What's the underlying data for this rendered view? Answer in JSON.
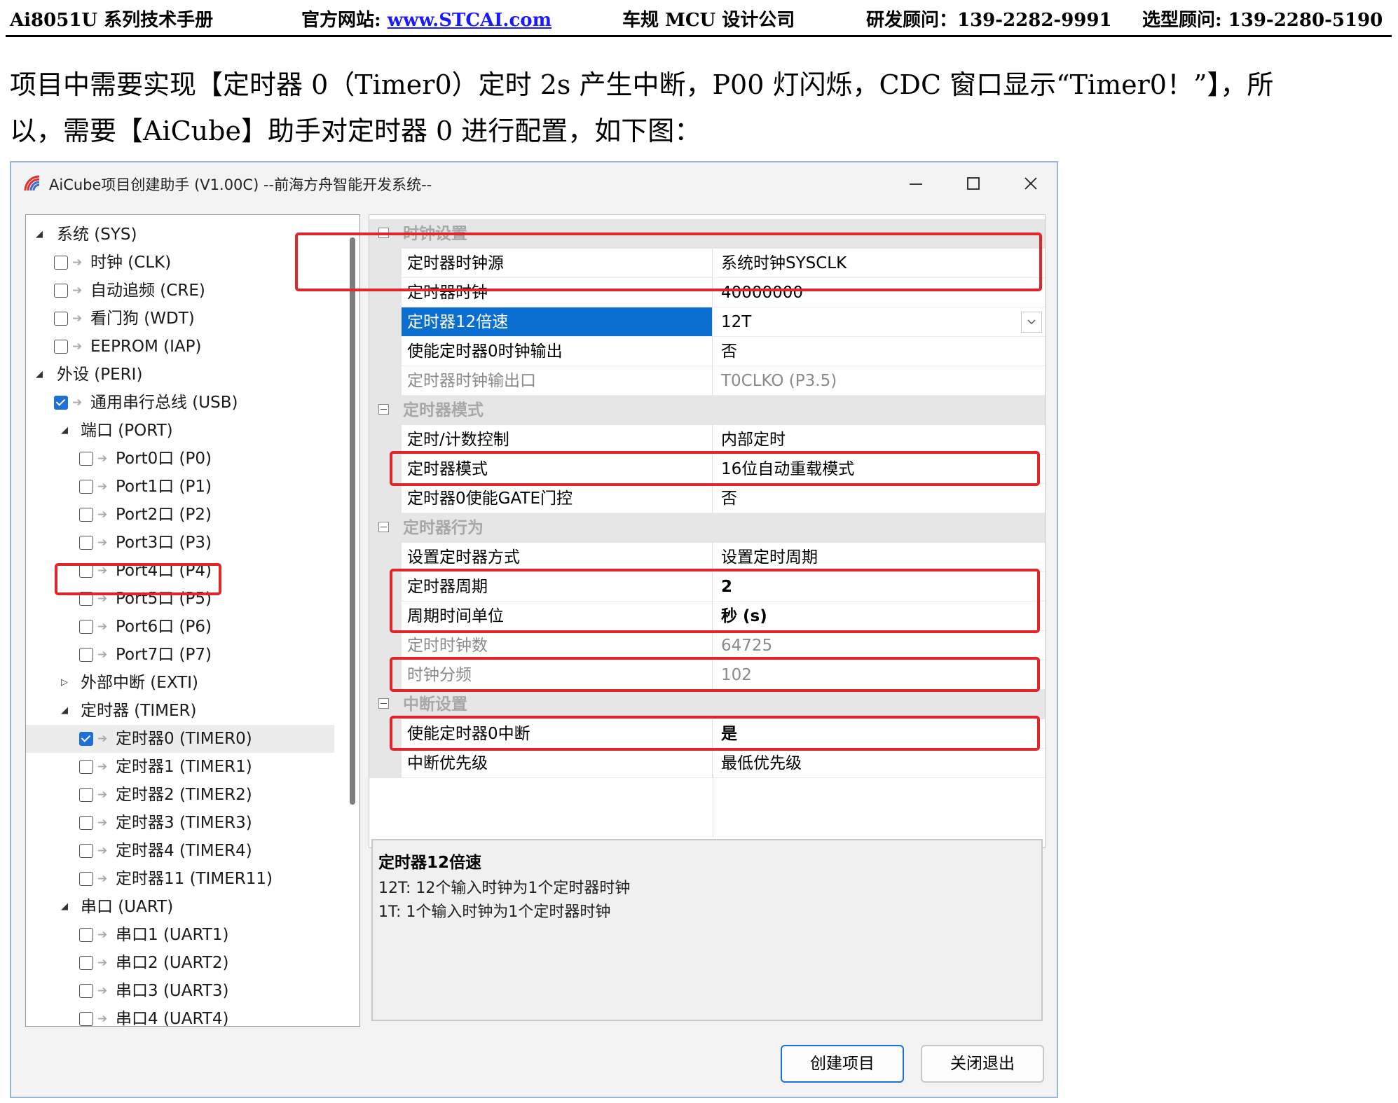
{
  "doc_header": {
    "manual": "Ai8051U 系列技术手册",
    "website_label": "官方网站: ",
    "website_url": "www.STCAI.com",
    "company": "车规 MCU 设计公司",
    "rd_advisor": "研发顾问：139-2282-9991",
    "selection_advisor": "选型顾问: 139-2280-5190"
  },
  "intro": {
    "line1": "项目中需要实现【定时器 0（Timer0）定时 2s 产生中断，P00 灯闪烁，CDC 窗口显示“Timer0！”】，所",
    "line2": "以，需要【AiCube】助手对定时器 0 进行配置，如下图："
  },
  "window": {
    "title": "AiCube项目创建助手 (V1.00C) --前海方舟智能开发系统--"
  },
  "tree": [
    {
      "label": "系统 (SYS)",
      "level": 0,
      "expander": "expanded"
    },
    {
      "label": "时钟 (CLK)",
      "level": 1,
      "checkbox": "unchecked"
    },
    {
      "label": "自动追频 (CRE)",
      "level": 1,
      "checkbox": "unchecked"
    },
    {
      "label": "看门狗 (WDT)",
      "level": 1,
      "checkbox": "unchecked"
    },
    {
      "label": "EEPROM (IAP)",
      "level": 1,
      "checkbox": "unchecked"
    },
    {
      "label": "外设 (PERI)",
      "level": 0,
      "expander": "expanded"
    },
    {
      "label": "通用串行总线 (USB)",
      "level": 1,
      "checkbox": "checked"
    },
    {
      "label": "端口 (PORT)",
      "level": 1,
      "expander": "expanded"
    },
    {
      "label": "Port0口 (P0)",
      "level": 2,
      "checkbox": "unchecked"
    },
    {
      "label": "Port1口 (P1)",
      "level": 2,
      "checkbox": "unchecked"
    },
    {
      "label": "Port2口 (P2)",
      "level": 2,
      "checkbox": "unchecked"
    },
    {
      "label": "Port3口 (P3)",
      "level": 2,
      "checkbox": "unchecked"
    },
    {
      "label": "Port4口 (P4)",
      "level": 2,
      "checkbox": "unchecked"
    },
    {
      "label": "Port5口 (P5)",
      "level": 2,
      "checkbox": "unchecked"
    },
    {
      "label": "Port6口 (P6)",
      "level": 2,
      "checkbox": "unchecked"
    },
    {
      "label": "Port7口 (P7)",
      "level": 2,
      "checkbox": "unchecked"
    },
    {
      "label": "外部中断 (EXTI)",
      "level": 1,
      "expander": "collapsed"
    },
    {
      "label": "定时器 (TIMER)",
      "level": 1,
      "expander": "expanded"
    },
    {
      "label": "定时器0 (TIMER0)",
      "level": 2,
      "checkbox": "checked",
      "selected": true
    },
    {
      "label": "定时器1 (TIMER1)",
      "level": 2,
      "checkbox": "unchecked"
    },
    {
      "label": "定时器2 (TIMER2)",
      "level": 2,
      "checkbox": "unchecked"
    },
    {
      "label": "定时器3 (TIMER3)",
      "level": 2,
      "checkbox": "unchecked"
    },
    {
      "label": "定时器4 (TIMER4)",
      "level": 2,
      "checkbox": "unchecked"
    },
    {
      "label": "定时器11 (TIMER11)",
      "level": 2,
      "checkbox": "unchecked"
    },
    {
      "label": "串口 (UART)",
      "level": 1,
      "expander": "expanded"
    },
    {
      "label": "串口1 (UART1)",
      "level": 2,
      "checkbox": "unchecked"
    },
    {
      "label": "串口2 (UART2)",
      "level": 2,
      "checkbox": "unchecked"
    },
    {
      "label": "串口3 (UART3)",
      "level": 2,
      "checkbox": "unchecked"
    },
    {
      "label": "串口4 (UART4)",
      "level": 2,
      "checkbox": "unchecked"
    }
  ],
  "properties": [
    {
      "section": "时钟设置"
    },
    {
      "name": "定时器时钟源",
      "value": "系统时钟SYSCLK"
    },
    {
      "name": "定时器时钟",
      "value": "40000000"
    },
    {
      "name": "定时器12倍速",
      "value": "12T",
      "selected": true,
      "dropdown": true
    },
    {
      "name": "使能定时器0时钟输出",
      "value": "否"
    },
    {
      "name": "定时器时钟输出口",
      "value": "T0CLKO (P3.5)",
      "disabled": true
    },
    {
      "section": "定时器模式"
    },
    {
      "name": "定时/计数控制",
      "value": "内部定时"
    },
    {
      "name": "定时器模式",
      "value": "16位自动重载模式"
    },
    {
      "name": "定时器0使能GATE门控",
      "value": "否"
    },
    {
      "section": "定时器行为"
    },
    {
      "name": "设置定时器方式",
      "value": "设置定时周期"
    },
    {
      "name": "定时器周期",
      "value": "2",
      "bold": true
    },
    {
      "name": "周期时间单位",
      "value": "秒 (s)",
      "bold": true
    },
    {
      "name": "定时时钟数",
      "value": "64725",
      "disabled": true
    },
    {
      "name": "时钟分频",
      "value": "102",
      "disabled": true
    },
    {
      "section": "中断设置"
    },
    {
      "name": "使能定时器0中断",
      "value": "是",
      "bold": true
    },
    {
      "name": "中断优先级",
      "value": "最低优先级"
    }
  ],
  "description": {
    "title": "定时器12倍速",
    "lines": [
      "12T:  12个输入时钟为1个定时器时钟",
      "1T:  1个输入时钟为1个定时器时钟"
    ]
  },
  "buttons": {
    "create": "创建项目",
    "close": "关闭退出"
  },
  "colors": {
    "selection_blue": "#0a6fd1",
    "highlight_red": "#e0262a",
    "checkbox_blue": "#1e6fd9"
  }
}
